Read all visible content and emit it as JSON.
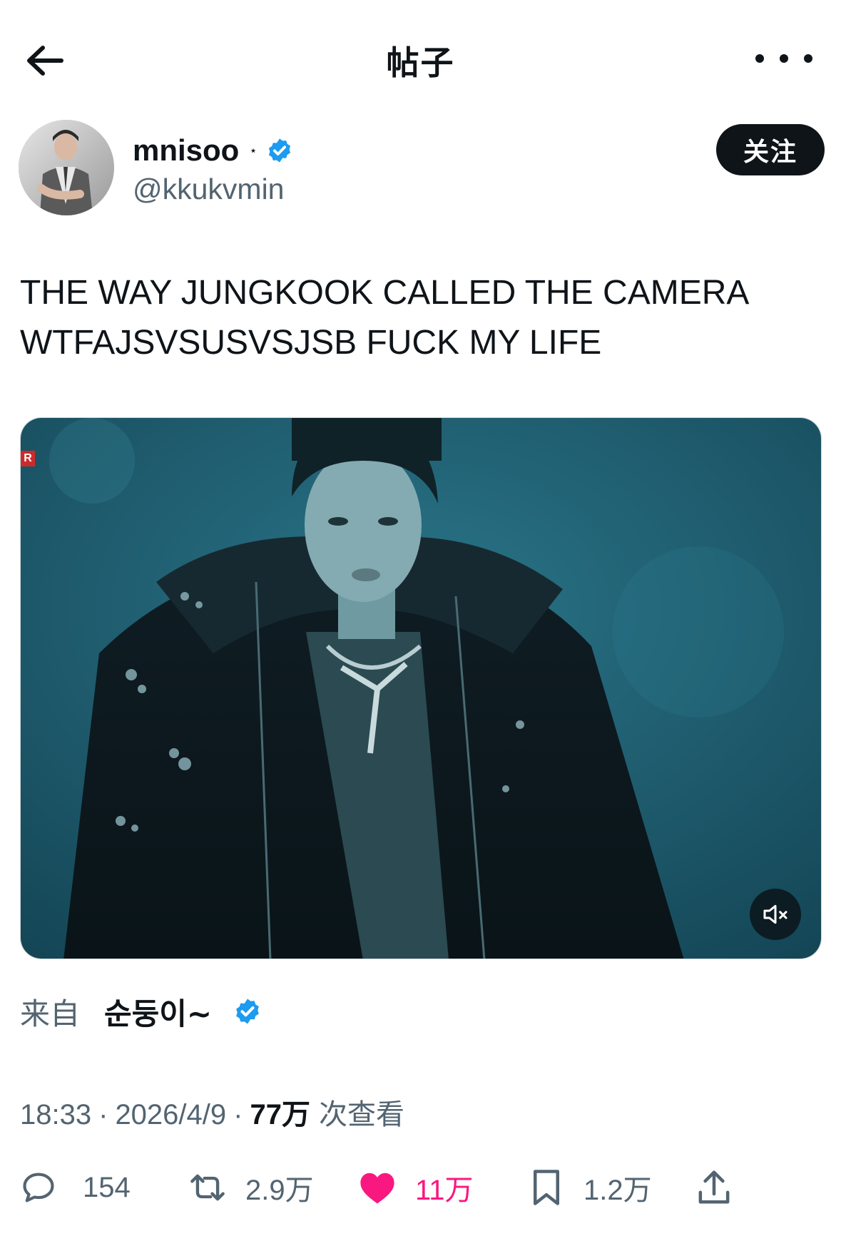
{
  "header": {
    "title": "帖子",
    "back_icon": "arrow-left-icon",
    "more_icon": "more-horizontal-icon"
  },
  "author": {
    "display_name": "mnisoo",
    "name_mark": "⋆",
    "handle": "@kkukvmin",
    "verified_icon": "verified-badge-icon",
    "follow_label": "关注"
  },
  "tweet": {
    "lines": [
      "THE WAY JUNGKOOK CALLED THE CAMERA",
      "WTFAJSVSUSVSJSB FUCK MY LIFE"
    ]
  },
  "media": {
    "type": "video",
    "rec_label": "R",
    "mute_icon": "speaker-muted-icon"
  },
  "source": {
    "prefix": "来自",
    "name": "순둥이~",
    "verified_icon": "verified-badge-icon"
  },
  "meta": {
    "time": "18:33",
    "separator": "·",
    "date": "2026/4/9",
    "views": "77万",
    "views_label": "次查看"
  },
  "actions": {
    "reply_count": "154",
    "repost_count": "2.9万",
    "like_count": "11万",
    "bookmark_count": "1.2万",
    "icons": [
      "reply-icon",
      "repost-icon",
      "like-icon",
      "bookmark-icon",
      "share-icon"
    ]
  },
  "colors": {
    "text": "#0f1419",
    "secondary": "#536471",
    "verified": "#1d9bf0",
    "like": "#f91880",
    "media_tint": "#1f5f72"
  }
}
